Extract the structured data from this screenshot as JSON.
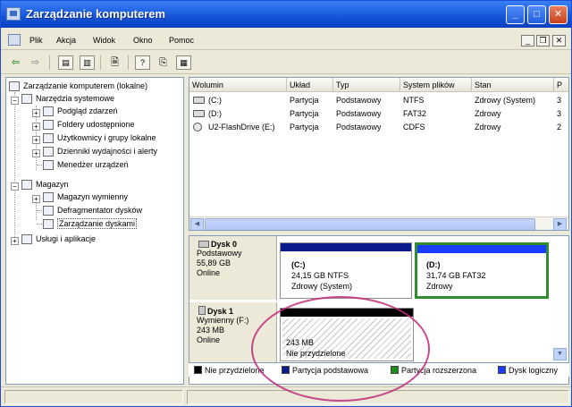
{
  "window": {
    "title": "Zarządzanie komputerem",
    "controls": {
      "minimize": "_",
      "maximize": "□",
      "close": "✕"
    }
  },
  "menubar": {
    "items": [
      "Plik",
      "Akcja",
      "Widok",
      "Okno",
      "Pomoc"
    ],
    "mdi_controls": {
      "minimize": "_",
      "restore": "❐",
      "close": "✕"
    }
  },
  "toolbar": {
    "buttons": [
      "back-arrow-icon",
      "forward-arrow-icon",
      "up-folder-icon",
      "show-hide-tree-icon",
      "properties-icon",
      "help-icon",
      "export-icon",
      "view-icon"
    ]
  },
  "tree": {
    "root": "Zarządzanie komputerem (lokalne)",
    "items": [
      {
        "label": "Narzędzia systemowe",
        "level": 1
      },
      {
        "label": "Podgląd zdarzeń",
        "level": 2
      },
      {
        "label": "Foldery udostępnione",
        "level": 2
      },
      {
        "label": "Użytkownicy i grupy lokalne",
        "level": 2
      },
      {
        "label": "Dzienniki wydajności i alerty",
        "level": 2
      },
      {
        "label": "Menedżer urządzeń",
        "level": 2
      },
      {
        "label": "Magazyn",
        "level": 1
      },
      {
        "label": "Magazyn wymienny",
        "level": 2
      },
      {
        "label": "Defragmentator dysków",
        "level": 2
      },
      {
        "label": "Zarządzanie dyskami",
        "level": 2
      },
      {
        "label": "Usługi i aplikacje",
        "level": 1
      }
    ]
  },
  "volumes": {
    "columns": [
      "Wolumin",
      "Układ",
      "Typ",
      "System plików",
      "Stan",
      "P"
    ],
    "rows": [
      {
        "volume": "(C:)",
        "layout": "Partycja",
        "type": "Podstawowy",
        "fs": "NTFS",
        "status": "Zdrowy (System)",
        "cap": "3"
      },
      {
        "volume": "(D:)",
        "layout": "Partycja",
        "type": "Podstawowy",
        "fs": "FAT32",
        "status": "Zdrowy",
        "cap": "3"
      },
      {
        "volume": "U2-FlashDrive (E:)",
        "layout": "Partycja",
        "type": "Podstawowy",
        "fs": "CDFS",
        "status": "Zdrowy",
        "cap": "2"
      }
    ]
  },
  "disks": [
    {
      "name": "Dysk 0",
      "type": "Podstawowy",
      "size": "55,89 GB",
      "state": "Online",
      "partitions": [
        {
          "label": "(C:)",
          "size": "24,15 GB NTFS",
          "status": "Zdrowy (System)"
        },
        {
          "label": "(D:)",
          "size": "31,74 GB FAT32",
          "status": "Zdrowy"
        }
      ]
    },
    {
      "name": "Dysk 1",
      "type": "Wymienny (F:)",
      "size": "243 MB",
      "state": "Online",
      "partitions": [
        {
          "label": "",
          "size": "243 MB",
          "status": "Nie przydzielone"
        }
      ]
    }
  ],
  "legend": [
    {
      "label": "Nie przydzielone",
      "color": "#000000"
    },
    {
      "label": "Partycja podstawowa",
      "color": "#0a1a8c"
    },
    {
      "label": "Partycja rozszerzona",
      "color": "#1a8c1a"
    },
    {
      "label": "Dysk logiczny",
      "color": "#1d3bff"
    }
  ],
  "colors": {
    "primary_partition": "#0a1a8c",
    "unallocated": "#000000",
    "selection": "#2f8c2f",
    "annotation": "#c02a7a"
  }
}
